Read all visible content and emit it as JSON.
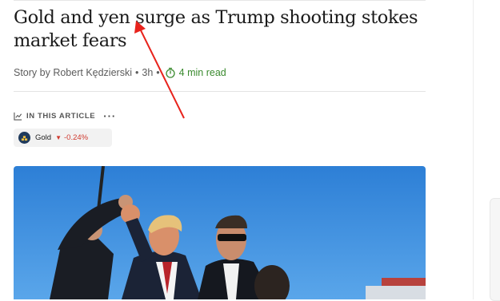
{
  "article": {
    "headline": "Gold and yen surge as Trump shooting stokes market fears",
    "byline": {
      "author": "Story by Robert Kędzierski",
      "separator": "•",
      "age": "3h",
      "read_time": "4 min read",
      "timer_icon": "stopwatch-icon"
    },
    "in_this_article": {
      "label": "IN THIS ARTICLE",
      "icon": "line-chart-icon",
      "more_label": "···"
    },
    "ticker": {
      "name": "Gold",
      "change": "-0.24%",
      "direction_glyph": "▼",
      "colors": {
        "negative": "#d03a2f",
        "logo_bg": "#1f3a5c"
      }
    },
    "hero_image": {
      "description_icon": "photo"
    }
  },
  "annotation": {
    "color": "#e8231c"
  },
  "colors": {
    "readtime": "#3a8a2e"
  }
}
